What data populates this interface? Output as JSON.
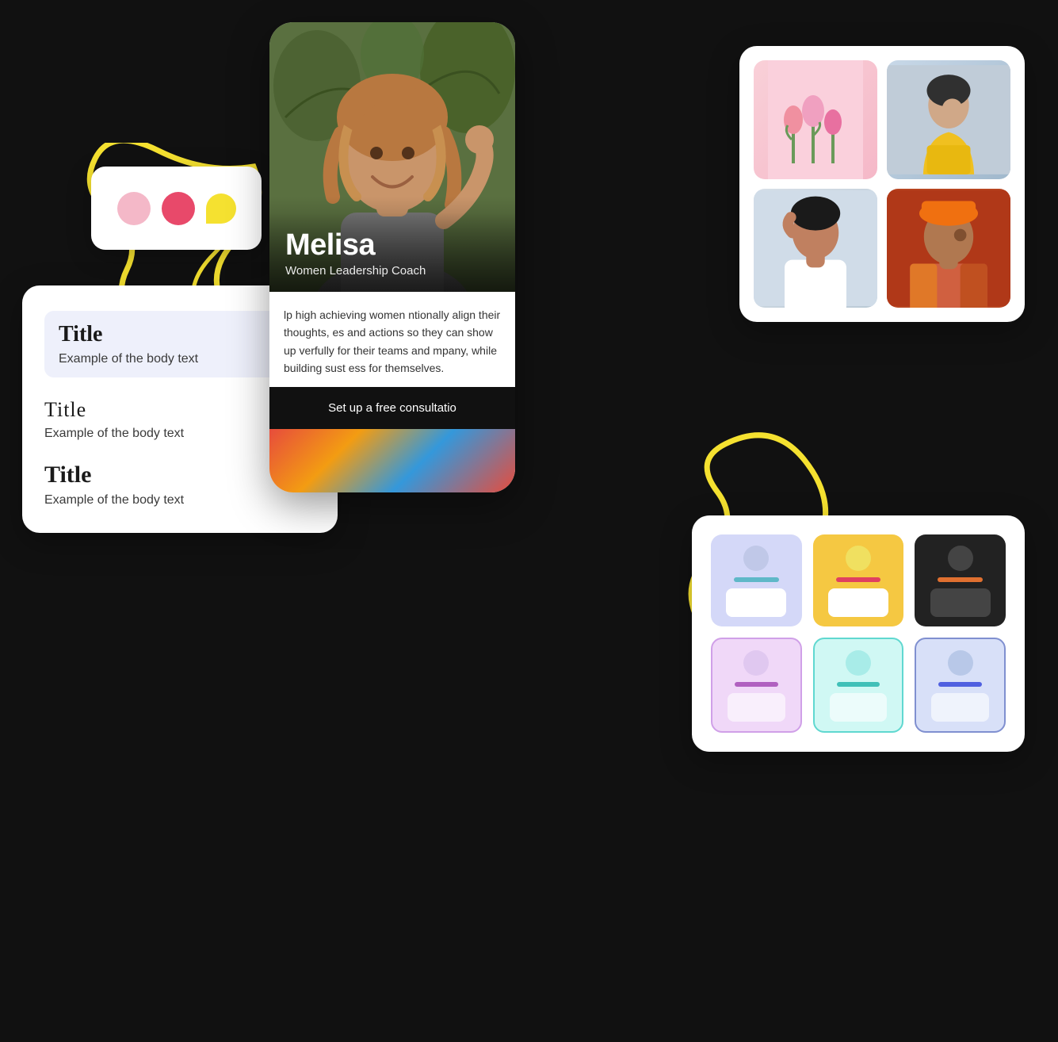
{
  "background_color": "#111111",
  "card_dots": {
    "dots": [
      {
        "color": "#f4b8c8",
        "label": "light-pink-dot"
      },
      {
        "color": "#e8496a",
        "label": "dark-pink-dot"
      },
      {
        "color": "#f5e130",
        "label": "yellow-dot"
      }
    ]
  },
  "card_typography": {
    "blocks": [
      {
        "title": "Title",
        "body": "Example of the body text",
        "style": "highlighted"
      },
      {
        "title": "Title",
        "body": "Example of the body text",
        "style": "outline"
      },
      {
        "title": "Title",
        "body": "Example of the body text",
        "style": "bold"
      }
    ]
  },
  "card_phone": {
    "hero_name": "Melisa",
    "hero_subtitle": "Women Leadership Coach",
    "body_text": "lp high achieving women ntionally align their thoughts, es and actions so they can show up verfully for their teams and mpany, while building sust ess for themselves.",
    "cta_text": "Set up a free consultatio"
  },
  "card_photo_grid": {
    "photos": [
      {
        "id": "photo-pink-flowers",
        "bg": "#f9d0d8"
      },
      {
        "id": "photo-yellow-jacket",
        "bg": "#c8d0d8"
      },
      {
        "id": "photo-woman-white",
        "bg": "#d4dce4"
      },
      {
        "id": "photo-orange-hat",
        "bg": "#b84520"
      }
    ]
  },
  "card_badge_grid": {
    "row1": [
      {
        "style": "purple",
        "bar_color": "#5fb8c8"
      },
      {
        "style": "yellow",
        "bar_color": "#e04060"
      },
      {
        "style": "dark",
        "bar_color": "#e07030"
      }
    ],
    "row2": [
      {
        "style": "pink",
        "bar_color": "#b060c0"
      },
      {
        "style": "teal",
        "bar_color": "#40c0b8"
      },
      {
        "style": "blue",
        "bar_color": "#5060e0"
      }
    ]
  },
  "yellow_accent_color": "#f5e130"
}
